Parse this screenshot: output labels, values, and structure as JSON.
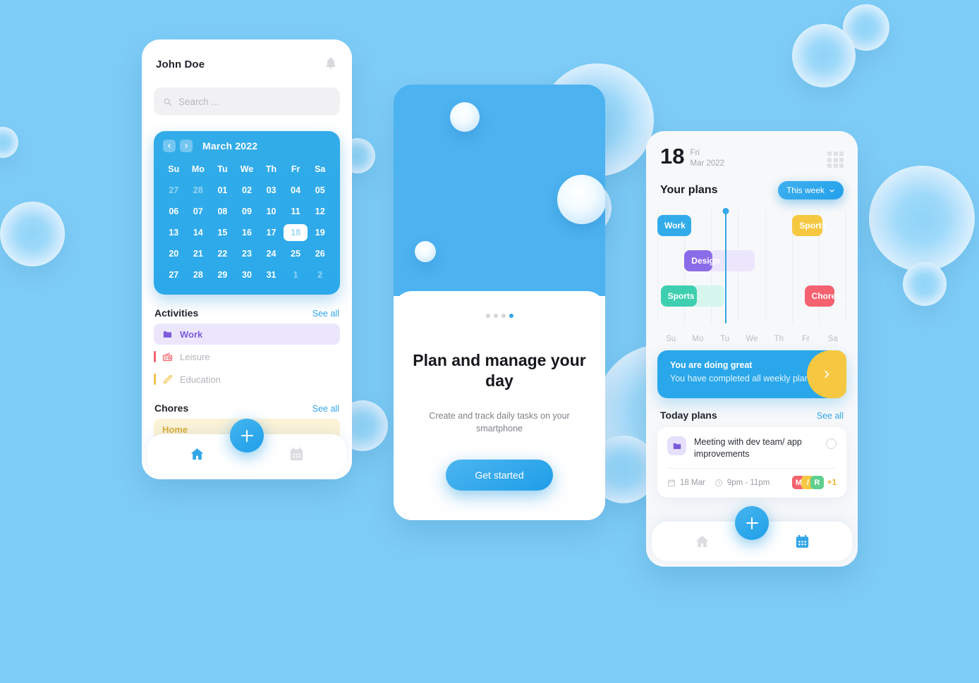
{
  "theme": {
    "bg": "#7ecdf7",
    "accent": "#33a6e8",
    "purple": "#8b6ce8",
    "yellow": "#f6c842",
    "red": "#f4636f",
    "teal": "#3ecfb0"
  },
  "left_phone": {
    "user_name": "John Doe",
    "bell_icon": "bell-icon",
    "search": {
      "placeholder": "Search ...",
      "icon": "search-icon"
    },
    "calendar": {
      "title": "March 2022",
      "prev_icon": "chevron-left-icon",
      "next_icon": "chevron-right-icon",
      "dow": [
        "Su",
        "Mo",
        "Tu",
        "We",
        "Th",
        "Fr",
        "Sa"
      ],
      "weeks": [
        [
          {
            "d": "27",
            "m": true
          },
          {
            "d": "28",
            "m": true
          },
          {
            "d": "01"
          },
          {
            "d": "02"
          },
          {
            "d": "03"
          },
          {
            "d": "04"
          },
          {
            "d": "05"
          }
        ],
        [
          {
            "d": "06"
          },
          {
            "d": "07"
          },
          {
            "d": "08"
          },
          {
            "d": "09"
          },
          {
            "d": "10"
          },
          {
            "d": "11"
          },
          {
            "d": "12"
          }
        ],
        [
          {
            "d": "13"
          },
          {
            "d": "14"
          },
          {
            "d": "15"
          },
          {
            "d": "16"
          },
          {
            "d": "17"
          },
          {
            "d": "18",
            "sel": true
          },
          {
            "d": "19"
          }
        ],
        [
          {
            "d": "20"
          },
          {
            "d": "21"
          },
          {
            "d": "22"
          },
          {
            "d": "23"
          },
          {
            "d": "24"
          },
          {
            "d": "25"
          },
          {
            "d": "26"
          }
        ],
        [
          {
            "d": "27"
          },
          {
            "d": "28"
          },
          {
            "d": "29"
          },
          {
            "d": "30"
          },
          {
            "d": "31"
          },
          {
            "d": "1",
            "m": true
          },
          {
            "d": "2",
            "m": true
          }
        ]
      ]
    },
    "activities": {
      "title": "Activities",
      "see_all": "See all",
      "items": [
        {
          "label": "Work",
          "icon": "folder-icon",
          "color": "#7b5bdb",
          "active": true
        },
        {
          "label": "Leisure",
          "icon": "radio-icon",
          "color": "#f4636f",
          "active": false
        },
        {
          "label": "Education",
          "icon": "pencil-icon",
          "color": "#f0c44a",
          "active": false
        }
      ]
    },
    "chores": {
      "title": "Chores",
      "see_all": "See all",
      "items": [
        {
          "label": "Home",
          "color": "#dcae3c"
        }
      ]
    },
    "nav": {
      "home_icon": "home-icon",
      "calendar_icon": "calendar-icon",
      "active": "home",
      "fab_icon": "plus-icon"
    }
  },
  "mid_phone": {
    "dots": 4,
    "active_dot": 4,
    "title": "Plan and manage your day",
    "subtitle": "Create and track daily tasks on your smartphone",
    "button_label": "Get started"
  },
  "right_phone": {
    "date_number": "18",
    "date_weekday": "Fri",
    "date_month": "Mar 2022",
    "grid_icon": "grid-icon",
    "plans_title": "Your plans",
    "week_filter": {
      "label": "This week",
      "icon": "chevron-down-icon"
    },
    "timeline": {
      "days": [
        "Su",
        "Mo",
        "Tu",
        "We",
        "Th",
        "Fr",
        "Sa"
      ],
      "now_day_index": 2,
      "bars": [
        {
          "label": "Work",
          "row": 0,
          "start": 0,
          "span": 1.25,
          "color": "#32ace9",
          "ghost": 0
        },
        {
          "label": "Sports",
          "row": 0,
          "start": 5,
          "span": 1.1,
          "color": "#f6c842",
          "ghost": 0
        },
        {
          "label": "Design",
          "row": 1,
          "start": 1,
          "span": 1.05,
          "color": "#8b6ce8",
          "ghost": 1.55,
          "ghost_color": "#ece6fd"
        },
        {
          "label": "Sports",
          "row": 2,
          "start": 0.12,
          "span": 1.35,
          "color": "#3ecfb0",
          "ghost": 1.0,
          "ghost_color": "#d6f6ee"
        },
        {
          "label": "Chores",
          "row": 2,
          "start": 5.45,
          "span": 1.1,
          "color": "#f4636f",
          "ghost": 0
        }
      ]
    },
    "banner": {
      "line1": "You are doing great",
      "line2": "You have completed all weekly plans",
      "arrow_icon": "chevron-right-icon"
    },
    "today": {
      "title": "Today plans",
      "see_all": "See all"
    },
    "task": {
      "folder_icon": "folder-icon",
      "title": "Meeting with dev team/ app improvements",
      "checkbox_icon": "circle-checkbox-icon",
      "date_icon": "calendar-icon",
      "date": "18 Mar",
      "time_icon": "clock-icon",
      "time": "9pm - 11pm",
      "avatars": [
        {
          "initial": "M",
          "color": "#f4636f"
        },
        {
          "initial": "/",
          "color": "#f6c842"
        },
        {
          "initial": "R",
          "color": "#5fcf8e"
        }
      ],
      "extra_count": "+1"
    },
    "nav": {
      "home_icon": "home-icon",
      "calendar_icon": "calendar-icon",
      "active": "calendar",
      "fab_icon": "plus-icon"
    }
  }
}
